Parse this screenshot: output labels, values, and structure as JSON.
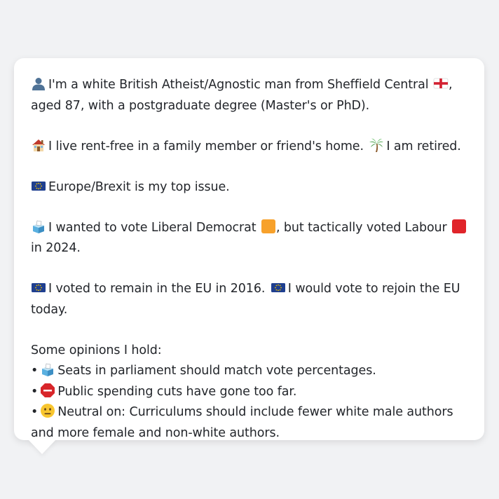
{
  "profile": {
    "p1_text_a": "I'm a white British Atheist/Agnostic man from Sheffield Central",
    "p1_text_b": ", aged 87, with a postgraduate degree (Master's or PhD).",
    "p2_text_a": "I live rent-free in a family member or friend's home.",
    "p2_text_b": "I am retired.",
    "p3_text": "Europe/Brexit is my top issue.",
    "p4_text_a": "I wanted to vote Liberal Democrat",
    "p4_text_b": ", but tactically voted Labour",
    "p4_text_c": "in 2024.",
    "p5_text_a": "I voted to remain in the EU in 2016.",
    "p5_text_b": "I would vote to rejoin the EU today.",
    "opinions_heading": "Some opinions I hold:",
    "bullet_char": "•",
    "opinions": [
      "Seats in parliament should match vote percentages.",
      "Public spending cuts have gone too far.",
      "Neutral on: Curriculums should include fewer white male authors and more female and non-white authors."
    ]
  },
  "icons": {
    "person": "person-silhouette-icon",
    "england_flag": "england-flag-icon",
    "house": "house-icon",
    "palm": "palm-tree-icon",
    "eu_flag": "eu-flag-icon",
    "ballot": "ballot-box-icon",
    "libdem_square": "orange-square-icon",
    "labour_square": "red-square-icon",
    "stop_sign": "stop-sign-icon",
    "neutral_face": "neutral-face-icon"
  },
  "colors": {
    "libdem": "#f7a12b",
    "labour": "#e0242a",
    "eu_blue": "#1f3f8f",
    "text": "#23262b"
  }
}
